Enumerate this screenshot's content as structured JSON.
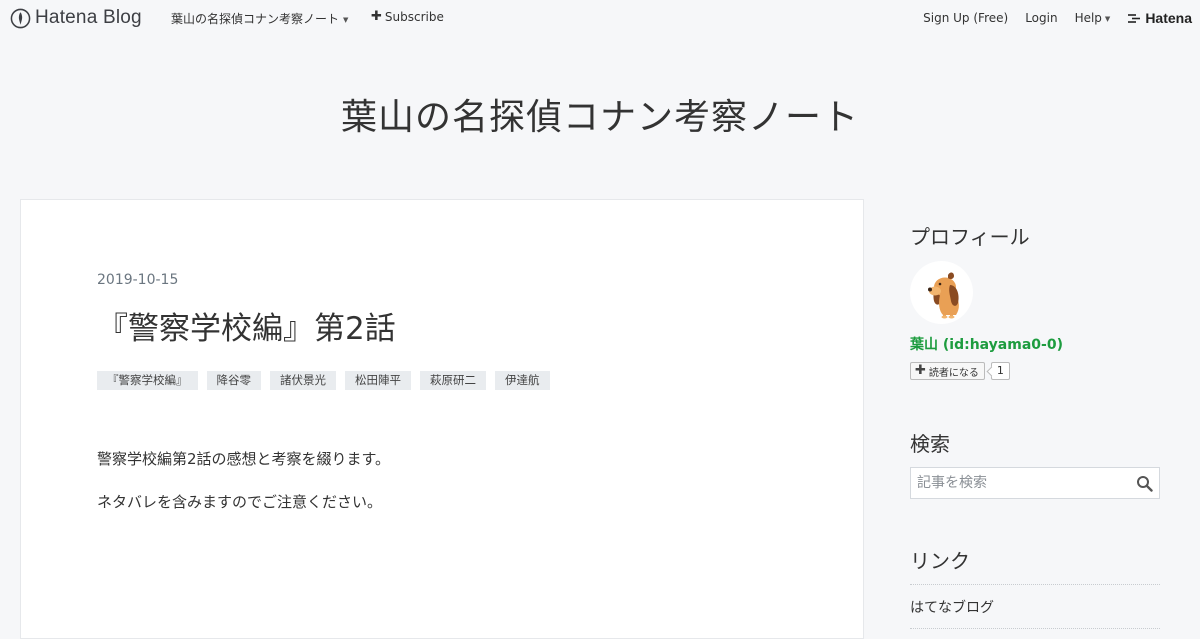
{
  "topbar": {
    "logo_text": "Hatena Blog",
    "blog_menu_label": "葉山の名探偵コナン考察ノート",
    "subscribe_label": "Subscribe",
    "signup_label": "Sign Up (Free)",
    "login_label": "Login",
    "help_label": "Help",
    "brand_label": "Hatena"
  },
  "blog": {
    "title": "葉山の名探偵コナン考察ノート"
  },
  "entry": {
    "date": "2019-10-15",
    "title": "『警察学校編』第2話",
    "tags": [
      "『警察学校編』",
      "降谷零",
      "諸伏景光",
      "松田陣平",
      "萩原研二",
      "伊達航"
    ],
    "paragraphs": [
      "警察学校編第2話の感想と考察を綴ります。",
      "ネタバレを含みますのでご注意ください。"
    ]
  },
  "sidebar": {
    "profile_heading": "プロフィール",
    "author_name": "葉山 (id:hayama0-0)",
    "reader_button_label": "読者になる",
    "reader_count": "1",
    "search_heading": "検索",
    "search_placeholder": "記事を検索",
    "links_heading": "リンク",
    "links": [
      "はてなブログ"
    ]
  },
  "colors": {
    "page_background": "#f6f7f9",
    "card_background": "#ffffff",
    "author_link": "#1d9c3f",
    "tag_background": "#e9ecef"
  },
  "icons": [
    "hatena-blog-logo-icon",
    "caret-down-icon",
    "plus-icon",
    "hatena-brand-icon",
    "search-icon",
    "dog-avatar"
  ]
}
